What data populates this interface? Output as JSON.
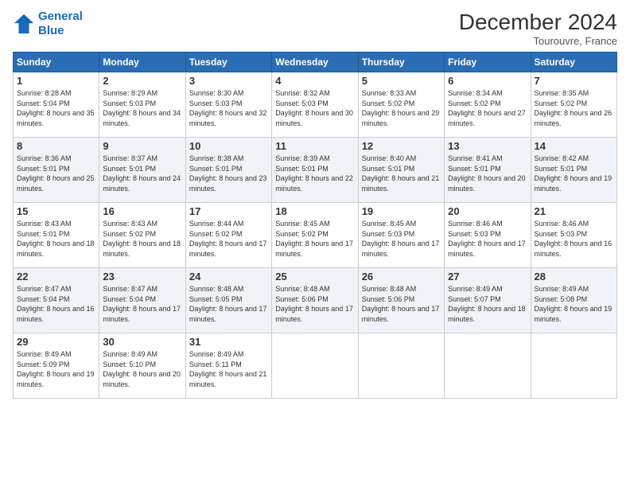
{
  "header": {
    "logo_line1": "General",
    "logo_line2": "Blue",
    "month": "December 2024",
    "location": "Tourouvre, France"
  },
  "weekdays": [
    "Sunday",
    "Monday",
    "Tuesday",
    "Wednesday",
    "Thursday",
    "Friday",
    "Saturday"
  ],
  "weeks": [
    [
      {
        "day": "1",
        "sunrise": "Sunrise: 8:28 AM",
        "sunset": "Sunset: 5:04 PM",
        "daylight": "Daylight: 8 hours and 35 minutes."
      },
      {
        "day": "2",
        "sunrise": "Sunrise: 8:29 AM",
        "sunset": "Sunset: 5:03 PM",
        "daylight": "Daylight: 8 hours and 34 minutes."
      },
      {
        "day": "3",
        "sunrise": "Sunrise: 8:30 AM",
        "sunset": "Sunset: 5:03 PM",
        "daylight": "Daylight: 8 hours and 32 minutes."
      },
      {
        "day": "4",
        "sunrise": "Sunrise: 8:32 AM",
        "sunset": "Sunset: 5:03 PM",
        "daylight": "Daylight: 8 hours and 30 minutes."
      },
      {
        "day": "5",
        "sunrise": "Sunrise: 8:33 AM",
        "sunset": "Sunset: 5:02 PM",
        "daylight": "Daylight: 8 hours and 29 minutes."
      },
      {
        "day": "6",
        "sunrise": "Sunrise: 8:34 AM",
        "sunset": "Sunset: 5:02 PM",
        "daylight": "Daylight: 8 hours and 27 minutes."
      },
      {
        "day": "7",
        "sunrise": "Sunrise: 8:35 AM",
        "sunset": "Sunset: 5:02 PM",
        "daylight": "Daylight: 8 hours and 26 minutes."
      }
    ],
    [
      {
        "day": "8",
        "sunrise": "Sunrise: 8:36 AM",
        "sunset": "Sunset: 5:01 PM",
        "daylight": "Daylight: 8 hours and 25 minutes."
      },
      {
        "day": "9",
        "sunrise": "Sunrise: 8:37 AM",
        "sunset": "Sunset: 5:01 PM",
        "daylight": "Daylight: 8 hours and 24 minutes."
      },
      {
        "day": "10",
        "sunrise": "Sunrise: 8:38 AM",
        "sunset": "Sunset: 5:01 PM",
        "daylight": "Daylight: 8 hours and 23 minutes."
      },
      {
        "day": "11",
        "sunrise": "Sunrise: 8:39 AM",
        "sunset": "Sunset: 5:01 PM",
        "daylight": "Daylight: 8 hours and 22 minutes."
      },
      {
        "day": "12",
        "sunrise": "Sunrise: 8:40 AM",
        "sunset": "Sunset: 5:01 PM",
        "daylight": "Daylight: 8 hours and 21 minutes."
      },
      {
        "day": "13",
        "sunrise": "Sunrise: 8:41 AM",
        "sunset": "Sunset: 5:01 PM",
        "daylight": "Daylight: 8 hours and 20 minutes."
      },
      {
        "day": "14",
        "sunrise": "Sunrise: 8:42 AM",
        "sunset": "Sunset: 5:01 PM",
        "daylight": "Daylight: 8 hours and 19 minutes."
      }
    ],
    [
      {
        "day": "15",
        "sunrise": "Sunrise: 8:43 AM",
        "sunset": "Sunset: 5:01 PM",
        "daylight": "Daylight: 8 hours and 18 minutes."
      },
      {
        "day": "16",
        "sunrise": "Sunrise: 8:43 AM",
        "sunset": "Sunset: 5:02 PM",
        "daylight": "Daylight: 8 hours and 18 minutes."
      },
      {
        "day": "17",
        "sunrise": "Sunrise: 8:44 AM",
        "sunset": "Sunset: 5:02 PM",
        "daylight": "Daylight: 8 hours and 17 minutes."
      },
      {
        "day": "18",
        "sunrise": "Sunrise: 8:45 AM",
        "sunset": "Sunset: 5:02 PM",
        "daylight": "Daylight: 8 hours and 17 minutes."
      },
      {
        "day": "19",
        "sunrise": "Sunrise: 8:45 AM",
        "sunset": "Sunset: 5:03 PM",
        "daylight": "Daylight: 8 hours and 17 minutes."
      },
      {
        "day": "20",
        "sunrise": "Sunrise: 8:46 AM",
        "sunset": "Sunset: 5:03 PM",
        "daylight": "Daylight: 8 hours and 17 minutes."
      },
      {
        "day": "21",
        "sunrise": "Sunrise: 8:46 AM",
        "sunset": "Sunset: 5:03 PM",
        "daylight": "Daylight: 8 hours and 16 minutes."
      }
    ],
    [
      {
        "day": "22",
        "sunrise": "Sunrise: 8:47 AM",
        "sunset": "Sunset: 5:04 PM",
        "daylight": "Daylight: 8 hours and 16 minutes."
      },
      {
        "day": "23",
        "sunrise": "Sunrise: 8:47 AM",
        "sunset": "Sunset: 5:04 PM",
        "daylight": "Daylight: 8 hours and 17 minutes."
      },
      {
        "day": "24",
        "sunrise": "Sunrise: 8:48 AM",
        "sunset": "Sunset: 5:05 PM",
        "daylight": "Daylight: 8 hours and 17 minutes."
      },
      {
        "day": "25",
        "sunrise": "Sunrise: 8:48 AM",
        "sunset": "Sunset: 5:06 PM",
        "daylight": "Daylight: 8 hours and 17 minutes."
      },
      {
        "day": "26",
        "sunrise": "Sunrise: 8:48 AM",
        "sunset": "Sunset: 5:06 PM",
        "daylight": "Daylight: 8 hours and 17 minutes."
      },
      {
        "day": "27",
        "sunrise": "Sunrise: 8:49 AM",
        "sunset": "Sunset: 5:07 PM",
        "daylight": "Daylight: 8 hours and 18 minutes."
      },
      {
        "day": "28",
        "sunrise": "Sunrise: 8:49 AM",
        "sunset": "Sunset: 5:08 PM",
        "daylight": "Daylight: 8 hours and 19 minutes."
      }
    ],
    [
      {
        "day": "29",
        "sunrise": "Sunrise: 8:49 AM",
        "sunset": "Sunset: 5:09 PM",
        "daylight": "Daylight: 8 hours and 19 minutes."
      },
      {
        "day": "30",
        "sunrise": "Sunrise: 8:49 AM",
        "sunset": "Sunset: 5:10 PM",
        "daylight": "Daylight: 8 hours and 20 minutes."
      },
      {
        "day": "31",
        "sunrise": "Sunrise: 8:49 AM",
        "sunset": "Sunset: 5:11 PM",
        "daylight": "Daylight: 8 hours and 21 minutes."
      },
      null,
      null,
      null,
      null
    ]
  ]
}
